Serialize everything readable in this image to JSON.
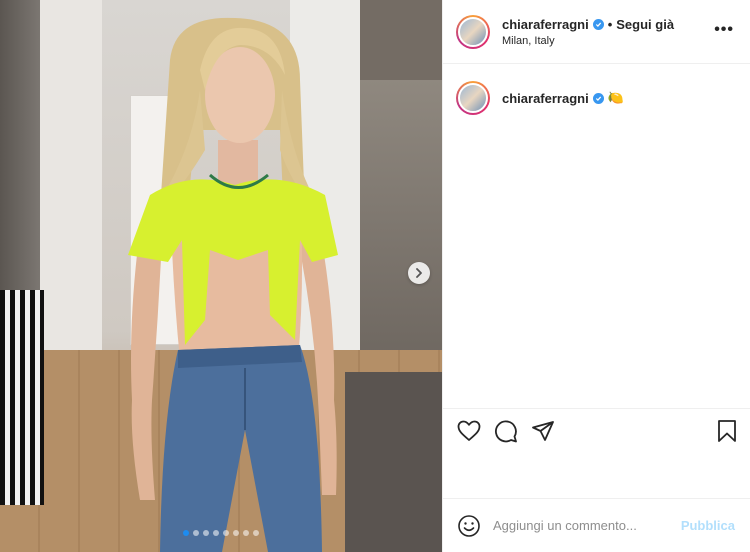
{
  "header": {
    "username": "chiaraferragni",
    "separator": "•",
    "follow_label": "Segui già",
    "location": "Milan, Italy",
    "more_label": "•••"
  },
  "caption": {
    "username": "chiaraferragni",
    "emoji": "🍋"
  },
  "media": {
    "slide_count": 8,
    "active_slide": 1
  },
  "actions": {
    "icons": [
      "heart-icon",
      "comment-icon",
      "share-icon",
      "bookmark-icon"
    ]
  },
  "comment": {
    "placeholder": "Aggiungi un commento...",
    "publish_label": "Pubblica"
  },
  "colors": {
    "verified": "#3897f0",
    "active_dot": "#1d8cf0",
    "publish_disabled": "#b2dffc",
    "top_color": "#d7f02f"
  }
}
